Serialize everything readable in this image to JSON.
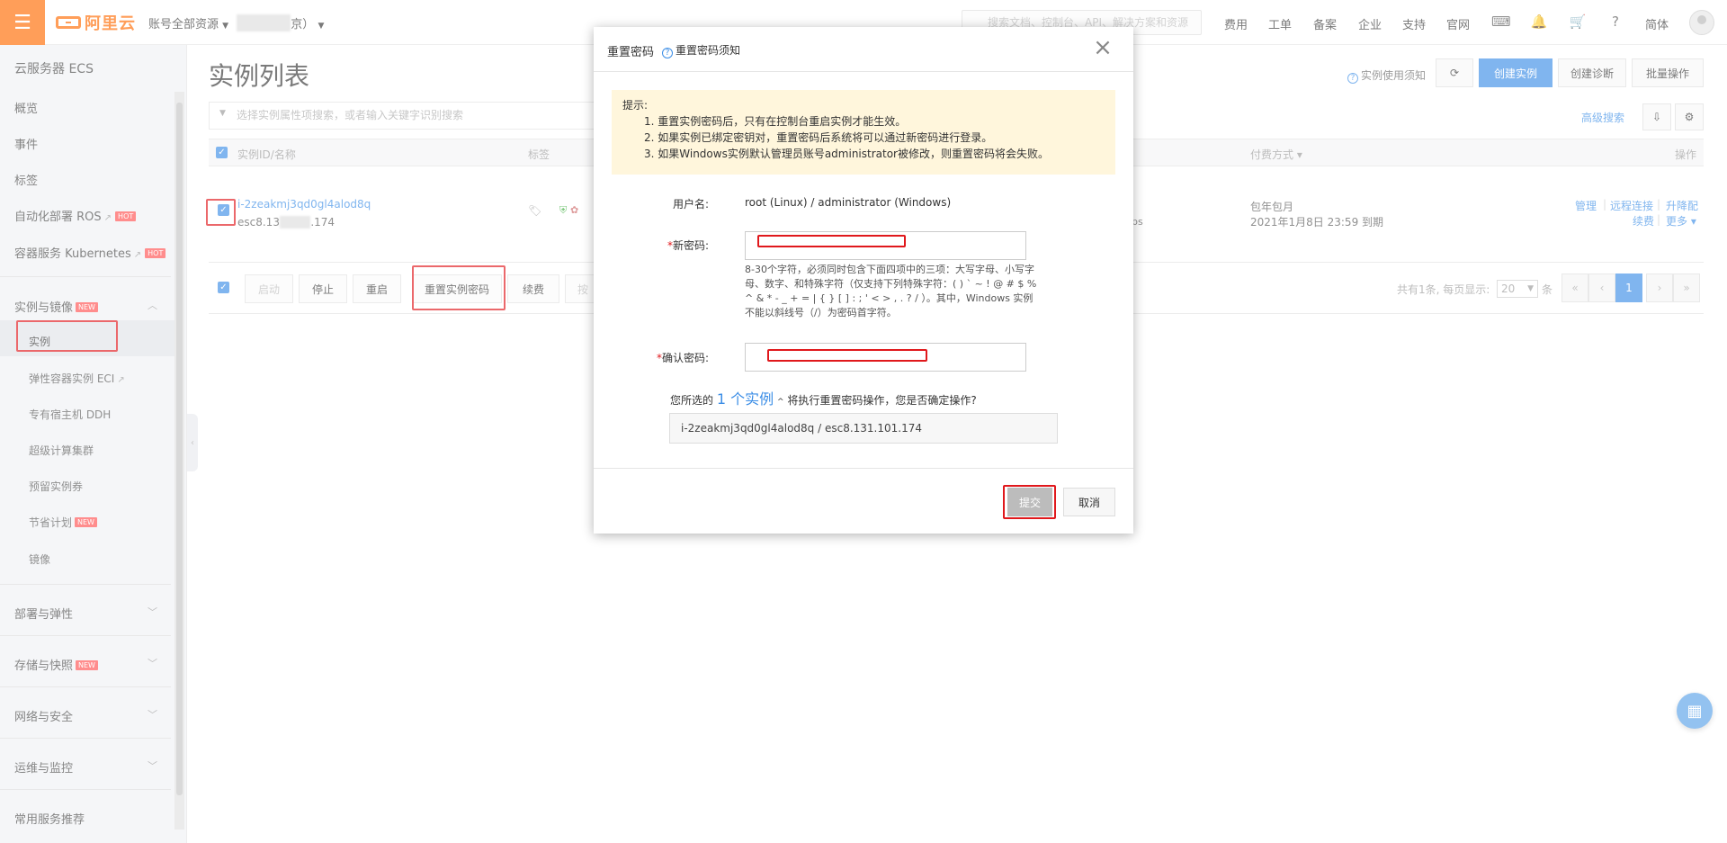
{
  "topbar": {
    "logo": "阿里云",
    "account_scope": "账号全部资源",
    "region_suffix": "京）",
    "search_placeholder": "搜索文档、控制台、API、解决方案和资源",
    "nav": [
      "费用",
      "工单",
      "备案",
      "企业",
      "支持",
      "官网"
    ],
    "lang": "简体"
  },
  "sidebar": {
    "title": "云服务器 ECS",
    "items_top": [
      "概览",
      "事件",
      "标签",
      "自动化部署 ROS",
      "容器服务 Kubernetes"
    ],
    "hot_badge": "HOT",
    "new_badge": "NEW",
    "group_instances": "实例与镜像",
    "sub_items": [
      "实例",
      "弹性容器实例 ECI",
      "专有宿主机 DDH",
      "超级计算集群",
      "预留实例券",
      "节省计划",
      "镜像"
    ],
    "groups": [
      "部署与弹性",
      "存储与快照",
      "网络与安全",
      "运维与监控",
      "常用服务推荐"
    ]
  },
  "main": {
    "title": "实例列表",
    "usage_notice": "实例使用须知",
    "btn_create": "创建实例",
    "btn_diag": "创建诊断",
    "btn_batch": "批量操作",
    "filter_placeholder": "选择实例属性项搜索，或者输入关键字识别搜索",
    "advanced_search": "高级搜索",
    "col_id": "实例ID/名称",
    "col_tag": "标签",
    "col_billing": "付费方式",
    "col_ops": "操作",
    "row": {
      "id": "i-2zeakmj3qd0gl4alod8q",
      "name_prefix": "esc8.13",
      "name_suffix": ".174",
      "partial": "ps",
      "billing": "包年包月",
      "expire": "2021年1月8日 23:59 到期",
      "op_manage": "管理",
      "op_remote": "远程连接",
      "op_upgrade": "升降配",
      "op_renew": "续费",
      "op_more": "更多"
    },
    "actions": [
      "启动",
      "停止",
      "重启",
      "重置实例密码",
      "续费",
      "按"
    ],
    "pagination": {
      "total_text": "共有1条, 每页显示:",
      "page_size": "20",
      "unit": "条",
      "current": "1"
    }
  },
  "modal": {
    "title": "重置密码",
    "help": "重置密码须知",
    "tip_title": "提示:",
    "tips": [
      "1. 重置实例密码后，只有在控制台重启实例才能生效。",
      "2. 如果实例已绑定密钥对，重置密码后系统将可以通过新密码进行登录。",
      "3. 如果Windows实例默认管理员账号administrator被修改，则重置密码将会失败。"
    ],
    "username_label": "用户名:",
    "username_value": "root (Linux) / administrator (Windows)",
    "new_pwd_label": "新密码:",
    "hint": "8-30个字符，必须同时包含下面四项中的三项：大写字母、小写字母、数字、和特殊字符（仅支持下列特殊字符：( ) ` ~ ! @ # $ % ^ & * - _ + = | { } [ ] : ; ' < > , . ? / ）。其中，Windows 实例不能以斜线号（/）为密码首字符。",
    "confirm_label": "确认密码:",
    "sel_prefix": "您所选的",
    "sel_count": "1 个实例",
    "sel_suffix": "将执行重置密码操作，您是否确定操作?",
    "sel_instance": "i-2zeakmj3qd0gl4alod8q / esc8.131.101.174",
    "btn_submit": "提交",
    "btn_cancel": "取消"
  }
}
